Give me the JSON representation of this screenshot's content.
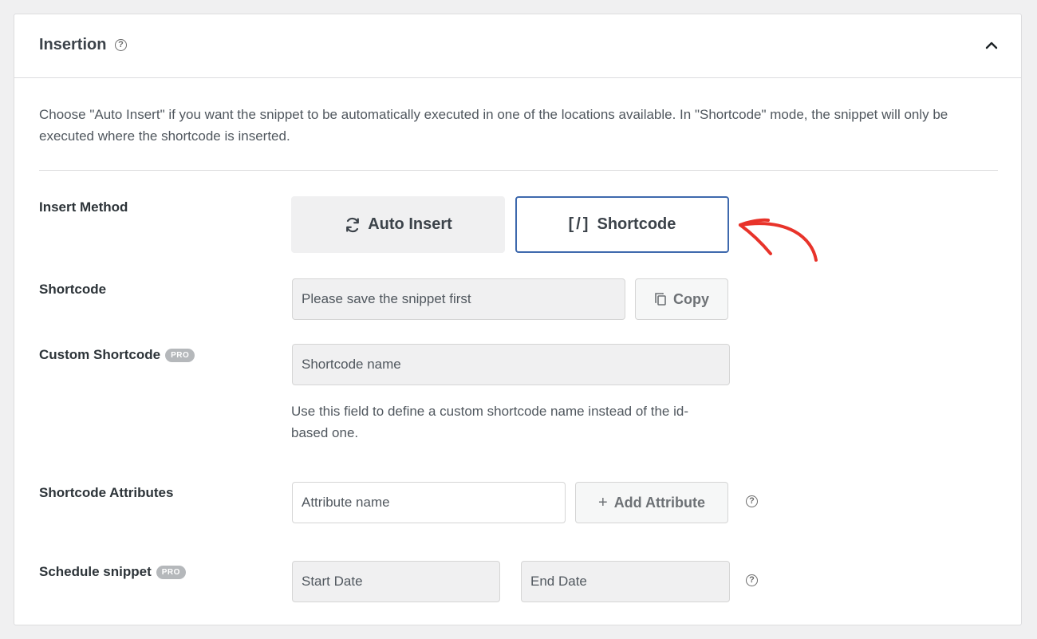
{
  "panel": {
    "title": "Insertion",
    "title_help_icon": "question-circle-icon",
    "collapse_icon": "chevron-up-icon"
  },
  "description": "Choose \"Auto Insert\" if you want the snippet to be automatically executed in one of the locations available. In \"Shortcode\" mode, the snippet will only be executed where the shortcode is inserted.",
  "insert_method": {
    "label": "Insert Method",
    "options": [
      {
        "label": "Auto Insert",
        "icon": "refresh-icon",
        "selected": false
      },
      {
        "label": "Shortcode",
        "icon": "[/]",
        "selected": true
      }
    ]
  },
  "shortcode": {
    "label": "Shortcode",
    "value": "Please save the snippet first",
    "copy_label": "Copy",
    "copy_icon": "copy-icon"
  },
  "custom_shortcode": {
    "label": "Custom Shortcode",
    "badge": "PRO",
    "placeholder": "Shortcode name",
    "hint": "Use this field to define a custom shortcode name instead of the id-based one."
  },
  "shortcode_attributes": {
    "label": "Shortcode Attributes",
    "placeholder": "Attribute name",
    "add_label": "Add Attribute",
    "add_icon": "+"
  },
  "schedule": {
    "label": "Schedule snippet",
    "badge": "PRO",
    "start_placeholder": "Start Date",
    "end_placeholder": "End Date"
  },
  "colors": {
    "accent": "#3e69ad",
    "annotation_arrow": "#e8332a"
  }
}
